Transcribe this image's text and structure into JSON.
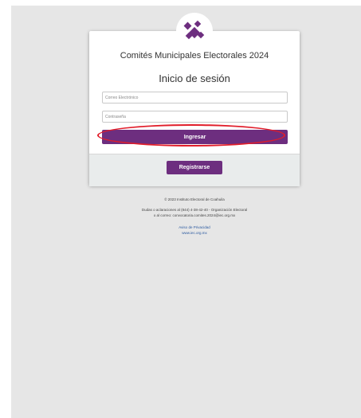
{
  "login": {
    "title": "Comités Municipales Electorales 2024",
    "subtitle": "Inicio de sesión",
    "email_placeholder": "Correo Electrónico",
    "password_placeholder": "Contraseña",
    "login_button": "Ingresar",
    "register_button": "Registrarse"
  },
  "footer": {
    "copyright": "© 2023 Instituto Electoral de Coahuila",
    "contact_line1": "Dudas o aclaraciones al (844) 4-38-42-40 - Organización Electoral",
    "contact_line2": "o al correo: convocatoria.comites.2024@iec.org.mx",
    "privacy_link": "Aviso de Privacidad",
    "website_link": "www.iec.org.mx"
  },
  "colors": {
    "primary": "#6d2e7f",
    "highlight": "#e11d2a",
    "background": "#e6e6e6"
  },
  "icons": {
    "logo": "iec-logo-icon"
  }
}
